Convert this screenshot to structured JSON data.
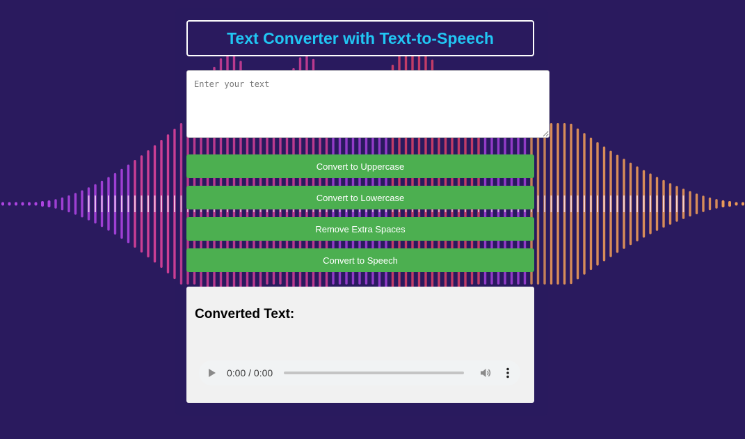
{
  "app": {
    "title": "Text Converter with Text-to-Speech"
  },
  "input": {
    "placeholder": "Enter your text",
    "value": ""
  },
  "buttons": {
    "uppercase": "Convert to Uppercase",
    "lowercase": "Convert to Lowercase",
    "remove_spaces": "Remove Extra Spaces",
    "speech": "Convert to Speech"
  },
  "output": {
    "heading": "Converted Text:",
    "text": ""
  },
  "audio": {
    "time": "0:00 / 0:00",
    "progress": 0,
    "play_icon": "play-icon",
    "volume_icon": "volume-icon",
    "menu_icon": "more-vert-icon"
  },
  "colors": {
    "background": "#2a1a5e",
    "title": "#21c6f3",
    "button": "#4caf50",
    "output_bg": "#f1f1f1",
    "wave_pink": "#e8459e",
    "wave_violet": "#b347e8",
    "wave_red": "#f2486a",
    "wave_orange": "#f6a158"
  }
}
